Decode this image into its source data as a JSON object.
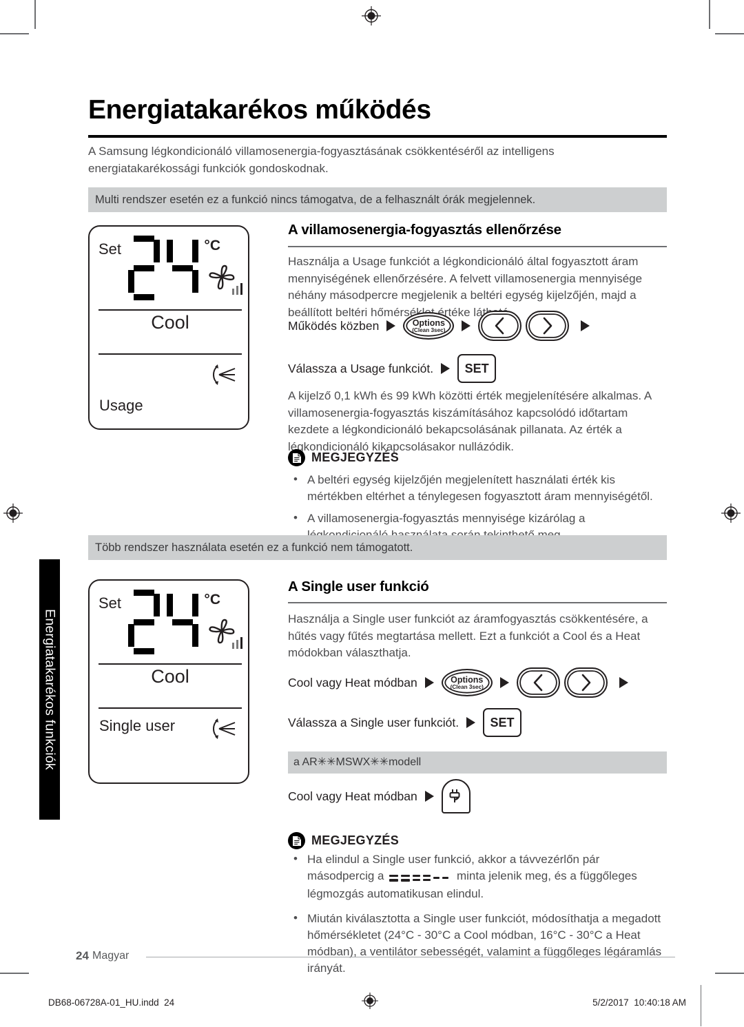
{
  "sidebar": {
    "tab_label": "Energiatakarékos funkciók"
  },
  "header": {
    "title": "Energiatakarékos működés",
    "intro": "A Samsung légkondicionáló villamosenergia-fogyasztásának csökkentéséről az intelligens energiatakarékossági funkciók gondoskodnak."
  },
  "bands": {
    "multi_system": "Multi rendszer esetén ez a funkció nincs támogatva, de a felhasznált órák megjelennek.",
    "multi_system_2": "Több rendszer használata esetén ez a funkció nem támogatott.",
    "model_note": "a AR✳✳MSWX✳✳modell"
  },
  "lcd_usage": {
    "set_label": "Set",
    "temperature": "24",
    "unit": "°C",
    "mode": "Cool",
    "function": "Usage",
    "fan_icon": "fan-icon",
    "swing_icon": "vertical-swing-icon"
  },
  "lcd_single_user": {
    "set_label": "Set",
    "temperature": "24",
    "unit": "°C",
    "mode": "Cool",
    "function": "Single user",
    "fan_icon": "fan-icon",
    "swing_icon": "vertical-swing-icon"
  },
  "section_usage": {
    "heading": "A villamosenergia-fogyasztás ellenőrzése",
    "paragraph1": "Használja a Usage funkciót a légkondicionáló által fogyasztott áram mennyiségének ellenőrzésére. A felvett villamosenergia mennyisége néhány másodpercre megjelenik a beltéri egység kijelzőjén, majd a beállított beltéri hőmérséklet értéke látható.",
    "step1_label": "Működés közben",
    "step2_label": "Válassza a Usage funkciót.",
    "paragraph2": "A kijelző 0,1 kWh és 99 kWh közötti érték megjelenítésére alkalmas. A villamosenergia-fogyasztás kiszámításához kapcsolódó időtartam kezdete a légkondicionáló bekapcsolásának pillanata. Az érték a légkondicionáló kikapcsolásakor nullázódik.",
    "note_title": "MEGJEGYZÉS",
    "notes": [
      "A beltéri egység kijelzőjén megjelenített használati érték kis mértékben eltérhet a ténylegesen fogyasztott áram mennyiségétől.",
      "A villamosenergia-fogyasztás mennyisége kizárólag a légkondicionáló használata során tekinthető meg."
    ]
  },
  "section_single_user": {
    "heading": "A Single user funkció",
    "paragraph1": "Használja a Single user funkciót az áramfogyasztás csökkentésére, a hűtés vagy fűtés megtartása mellett. Ezt a funkciót a Cool és a Heat módokban választhatja.",
    "step1_label": "Cool vagy Heat módban",
    "step2_label": "Válassza a Single user funkciót.",
    "step3_label": "Cool vagy Heat módban",
    "note_title": "MEGJEGYZÉS",
    "note1_part1": "Ha elindul a Single user funkció, akkor a távvezérlőn pár másodpercig a",
    "note1_part2": "minta jelenik meg, és a függőleges légmozgás automatikusan elindul.",
    "note2": "Miután kiválasztotta a Single user funkciót, módosíthatja a megadott hőmérsékletet (24°C - 30°C a Cool módban, 16°C - 30°C a Heat módban), a ventilátor sebességét, valamint a függőleges légáramlás irányát."
  },
  "buttons": {
    "options_main": "Options",
    "options_sub": "(Clean 3sec)",
    "arrow_left": "‹",
    "arrow_right": "›",
    "set": "SET",
    "plug_icon": "plug-leaf-icon"
  },
  "footer": {
    "page_number": "24",
    "language": "Magyar",
    "file_name": "DB68-06728A-01_HU.indd",
    "file_page": "24",
    "date": "5/2/2017",
    "time": "10:40:18 AM"
  },
  "colors": {
    "band_gray": "#cdcfd0",
    "body_text": "#4d4d4f",
    "heading": "#000000",
    "rule": "#6d6e71"
  }
}
